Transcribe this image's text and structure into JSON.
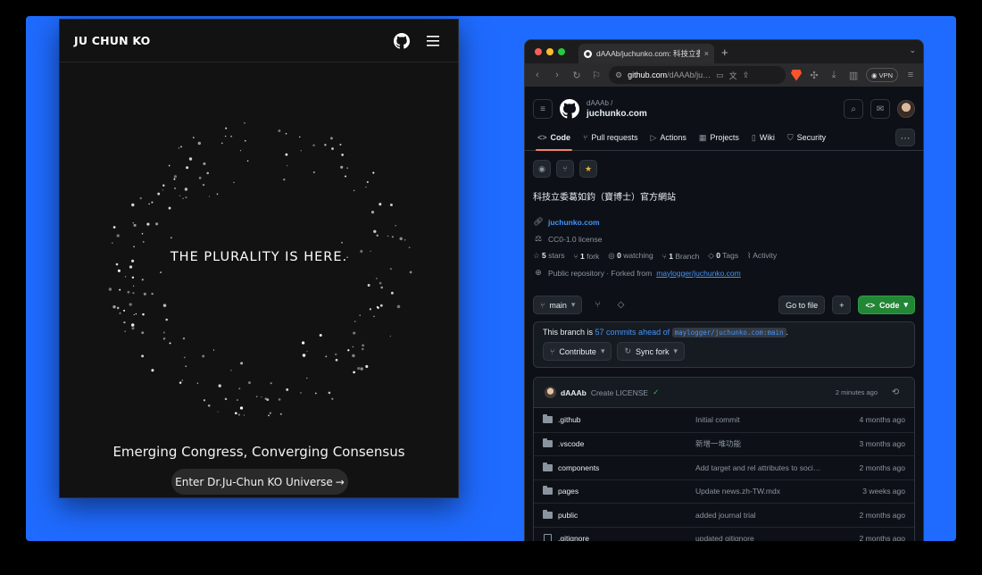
{
  "left_site": {
    "brand": "JU CHUN KO",
    "hero_title": "THE PLURALITY IS HERE.",
    "tagline": "Emerging Congress, Converging Consensus",
    "cta_label": "Enter Dr.Ju-Chun KO Universe",
    "cta_arrow": "→"
  },
  "browser": {
    "tab_title": "dAAAb/juchunko.com: 科技立委",
    "tab_close": "×",
    "new_tab": "+",
    "url_host": "github.com",
    "url_path": "/dAAAb/ju…",
    "vpn_label": "VPN"
  },
  "github": {
    "owner": "dAAAb /",
    "repo": "juchunko.com",
    "tabs": [
      {
        "label": "Code",
        "icon": "<>"
      },
      {
        "label": "Pull requests",
        "icon": "⑂"
      },
      {
        "label": "Actions",
        "icon": "▷"
      },
      {
        "label": "Projects",
        "icon": "▦"
      },
      {
        "label": "Wiki",
        "icon": "▯"
      },
      {
        "label": "Security",
        "icon": "⛉"
      }
    ],
    "description": "科技立委葛如鈞（寶博士）官方網站",
    "website": "juchunko.com",
    "license": "CC0-1.0 license",
    "stats": {
      "stars_count": "5",
      "stars_label": "stars",
      "forks_count": "1",
      "forks_label": "fork",
      "watching_count": "0",
      "watching_label": "watching",
      "branch_count": "1",
      "branch_label": "Branch",
      "tags_count": "0",
      "tags_label": "Tags",
      "activity_label": "Activity"
    },
    "visibility": "Public repository · Forked from",
    "forked_from": "maylogger/juchunko.com",
    "branch": "main",
    "go_to_file": "Go to file",
    "add_label": "+",
    "code_button": "Code",
    "fork_status_prefix": "This branch is",
    "fork_status_link": "57 commits ahead of",
    "fork_status_ref": "maylogger/juchunko.com:main",
    "fork_status_suffix": ".",
    "contribute": "Contribute",
    "sync_fork": "Sync fork",
    "latest_commit": {
      "author": "dAAAb",
      "message": "Create LICENSE",
      "check": "✓",
      "time": "2 minutes ago"
    },
    "files": [
      {
        "name": ".github",
        "message": "Initial commit",
        "date": "4 months ago",
        "type": "dir"
      },
      {
        "name": ".vscode",
        "message": "新增一堆功能",
        "date": "3 months ago",
        "type": "dir"
      },
      {
        "name": "components",
        "message": "Add target and rel attributes to soci…",
        "date": "2 months ago",
        "type": "dir"
      },
      {
        "name": "pages",
        "message": "Update news.zh-TW.mdx",
        "date": "3 weeks ago",
        "type": "dir"
      },
      {
        "name": "public",
        "message": "added journal trial",
        "date": "2 months ago",
        "type": "dir"
      },
      {
        "name": ".gitignore",
        "message": "updated gitignore",
        "date": "2 months ago",
        "type": "file"
      }
    ]
  },
  "colors": {
    "backdrop": "#1f6bff",
    "github_bg": "#0d1117",
    "link": "#4493f8",
    "green_button": "#238636",
    "active_tab_underline": "#f78166"
  }
}
